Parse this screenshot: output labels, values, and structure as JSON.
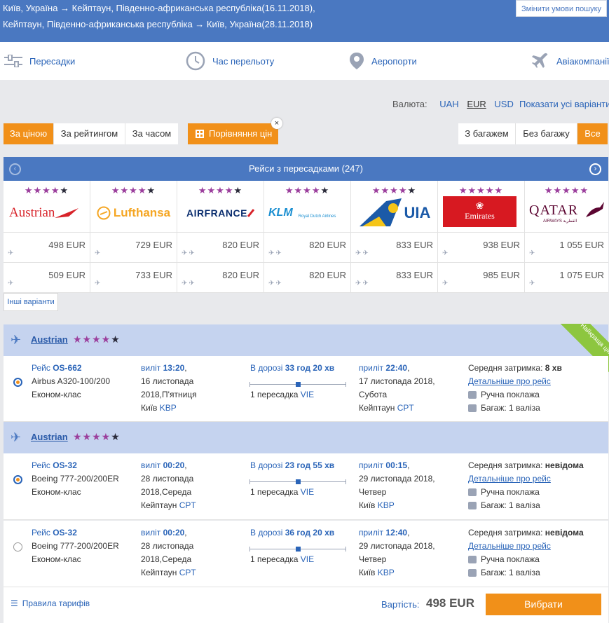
{
  "search": {
    "route_out": "Київ, Україна → Кейптаун, Південно-африканська республіка(16.11.2018),",
    "route_back": "Кейптаун, Південно-африканська республіка → Київ, Україна(28.11.2018)",
    "change_label": "Змінити умови пошуку"
  },
  "filters": [
    {
      "label": "Пересадки",
      "icon": "sliders-icon"
    },
    {
      "label": "Час перельоту",
      "icon": "clock-icon"
    },
    {
      "label": "Аеропорти",
      "icon": "map-pin-icon"
    },
    {
      "label": "Авіакомпанії",
      "icon": "airplane-icon"
    }
  ],
  "currency": {
    "label": "Валюта:",
    "options": [
      "UAH",
      "EUR",
      "USD"
    ],
    "selected": "EUR"
  },
  "show_all": "Показати усі варіанти",
  "sort": {
    "options": [
      "За ціною",
      "За рейтингом",
      "За часом"
    ],
    "selected": "За ціною"
  },
  "compare_label": "Порівняння цін",
  "close_glyph": "×",
  "baggage": {
    "options": [
      "З багажем",
      "Без багажу",
      "Все"
    ],
    "selected": "Все"
  },
  "matrix": {
    "title": "Рейси з пересадками (247)",
    "prev_glyph": "‹",
    "next_glyph": "›",
    "airlines": [
      {
        "name": "Austrian",
        "stars": 4,
        "prices": [
          "498 EUR",
          "509 EUR"
        ],
        "stops": [
          1,
          1
        ]
      },
      {
        "name": "Lufthansa",
        "stars": 4,
        "prices": [
          "729 EUR",
          "733 EUR"
        ],
        "stops": [
          1,
          1
        ]
      },
      {
        "name": "AIRFRANCE",
        "stars": 4,
        "prices": [
          "820 EUR",
          "820 EUR"
        ],
        "stops": [
          2,
          2
        ]
      },
      {
        "name": "KLM",
        "sub": "Royal Dutch Airlines",
        "stars": 4,
        "prices": [
          "820 EUR",
          "820 EUR"
        ],
        "stops": [
          2,
          2
        ]
      },
      {
        "name": "UIA",
        "stars": 4,
        "prices": [
          "833 EUR",
          "833 EUR"
        ],
        "stops": [
          2,
          2
        ]
      },
      {
        "name": "Emirates",
        "stars": 5,
        "prices": [
          "938 EUR",
          "985 EUR"
        ],
        "stops": [
          1,
          1
        ]
      },
      {
        "name": "QATAR",
        "sub": "AIRWAYS القطرية",
        "stars": 5,
        "prices": [
          "1 055 EUR",
          "1 075 EUR"
        ],
        "stops": [
          1,
          1
        ]
      }
    ],
    "more_label": "Інші варіанти"
  },
  "ribbon": "Найкраща ціна",
  "segments": [
    {
      "airline": "Austrian",
      "stars": 4,
      "flights": [
        {
          "selected": true,
          "flight_label": "Рейс",
          "flight_no": "OS-662",
          "aircraft": "Airbus A320-100/200",
          "class": "Економ-клас",
          "dep_label": "виліт",
          "dep_time": "13:20",
          "dep_date1": "16 листопада",
          "dep_date2": "2018,П'ятниця",
          "dep_city": "Київ",
          "dep_code": "KBP",
          "dur_label": "В дорозі",
          "duration": "33 год 20 хв",
          "stops_label": "1 пересадка",
          "stop_code": "VIE",
          "arr_label": "приліт",
          "arr_time": "22:40",
          "arr_date1": "17 листопада 2018,",
          "arr_date2": "Субота",
          "arr_city": "Кейптаун",
          "arr_code": "CPT",
          "delay_label": "Середня затримка:",
          "delay": "8 хв",
          "details": "Детальніше про рейс",
          "hand": "Ручна поклажа",
          "baggage": "Багаж: 1 валіза"
        }
      ]
    },
    {
      "airline": "Austrian",
      "stars": 4,
      "flights": [
        {
          "selected": true,
          "flight_label": "Рейс",
          "flight_no": "OS-32",
          "aircraft": "Boeing 777-200/200ER",
          "class": "Економ-клас",
          "dep_label": "виліт",
          "dep_time": "00:20",
          "dep_date1": "28 листопада",
          "dep_date2": "2018,Середа",
          "dep_city": "Кейптаун",
          "dep_code": "CPT",
          "dur_label": "В дорозі",
          "duration": "23 год 55 хв",
          "stops_label": "1 пересадка",
          "stop_code": "VIE",
          "arr_label": "приліт",
          "arr_time": "00:15",
          "arr_date1": "29 листопада 2018,",
          "arr_date2": "Четвер",
          "arr_city": "Київ",
          "arr_code": "KBP",
          "delay_label": "Середня затримка:",
          "delay": "невідома",
          "details": "Детальніше про рейс",
          "hand": "Ручна поклажа",
          "baggage": "Багаж: 1 валіза"
        },
        {
          "selected": false,
          "flight_label": "Рейс",
          "flight_no": "OS-32",
          "aircraft": "Boeing 777-200/200ER",
          "class": "Економ-клас",
          "dep_label": "виліт",
          "dep_time": "00:20",
          "dep_date1": "28 листопада",
          "dep_date2": "2018,Середа",
          "dep_city": "Кейптаун",
          "dep_code": "CPT",
          "dur_label": "В дорозі",
          "duration": "36 год 20 хв",
          "stops_label": "1 пересадка",
          "stop_code": "VIE",
          "arr_label": "приліт",
          "arr_time": "12:40",
          "arr_date1": "29 листопада 2018,",
          "arr_date2": "Четвер",
          "arr_city": "Київ",
          "arr_code": "KBP",
          "delay_label": "Середня затримка:",
          "delay": "невідома",
          "details": "Детальніше про рейс",
          "hand": "Ручна поклажа",
          "baggage": "Багаж: 1 валіза"
        }
      ]
    }
  ],
  "footer": {
    "rules": "Правила тарифів",
    "cost_label": "Вартість:",
    "cost": "498 EUR",
    "choose": "Вибрати"
  },
  "colors": {
    "accent": "#f19019",
    "brand": "#4a78c1",
    "link": "#2a64b8",
    "star": "#9b3e9c",
    "best_price": "#8dc63f"
  }
}
